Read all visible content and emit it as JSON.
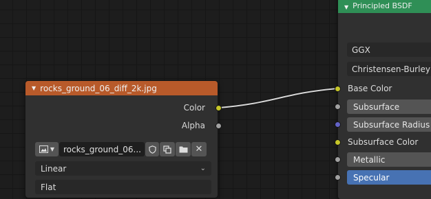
{
  "image_node": {
    "title": "rocks_ground_06_diff_2k.jpg",
    "outputs": [
      "Color",
      "Alpha"
    ],
    "image_name": "rocks_ground_06...",
    "interpolation": "Linear",
    "projection": "Flat",
    "header_color": "#b85a2a"
  },
  "bsdf_node": {
    "title": "Principled BSDF",
    "distribution": "GGX",
    "subsurface_method": "Christensen-Burley",
    "inputs": [
      "Base Color",
      "Subsurface",
      "Subsurface Radius",
      "Subsurface Color",
      "Metallic",
      "Specular"
    ],
    "header_color": "#2f8f56"
  },
  "colors": {
    "socket_color": "#c7c729",
    "socket_gray": "#a1a1a1",
    "socket_vector": "#6363c7",
    "selected_field": "#4772b3",
    "link": "#d8d8d8"
  },
  "icons": [
    "image-type-icon",
    "chevron-down-icon",
    "fake-user-shield-icon",
    "duplicate-icon",
    "folder-icon",
    "close-icon"
  ]
}
